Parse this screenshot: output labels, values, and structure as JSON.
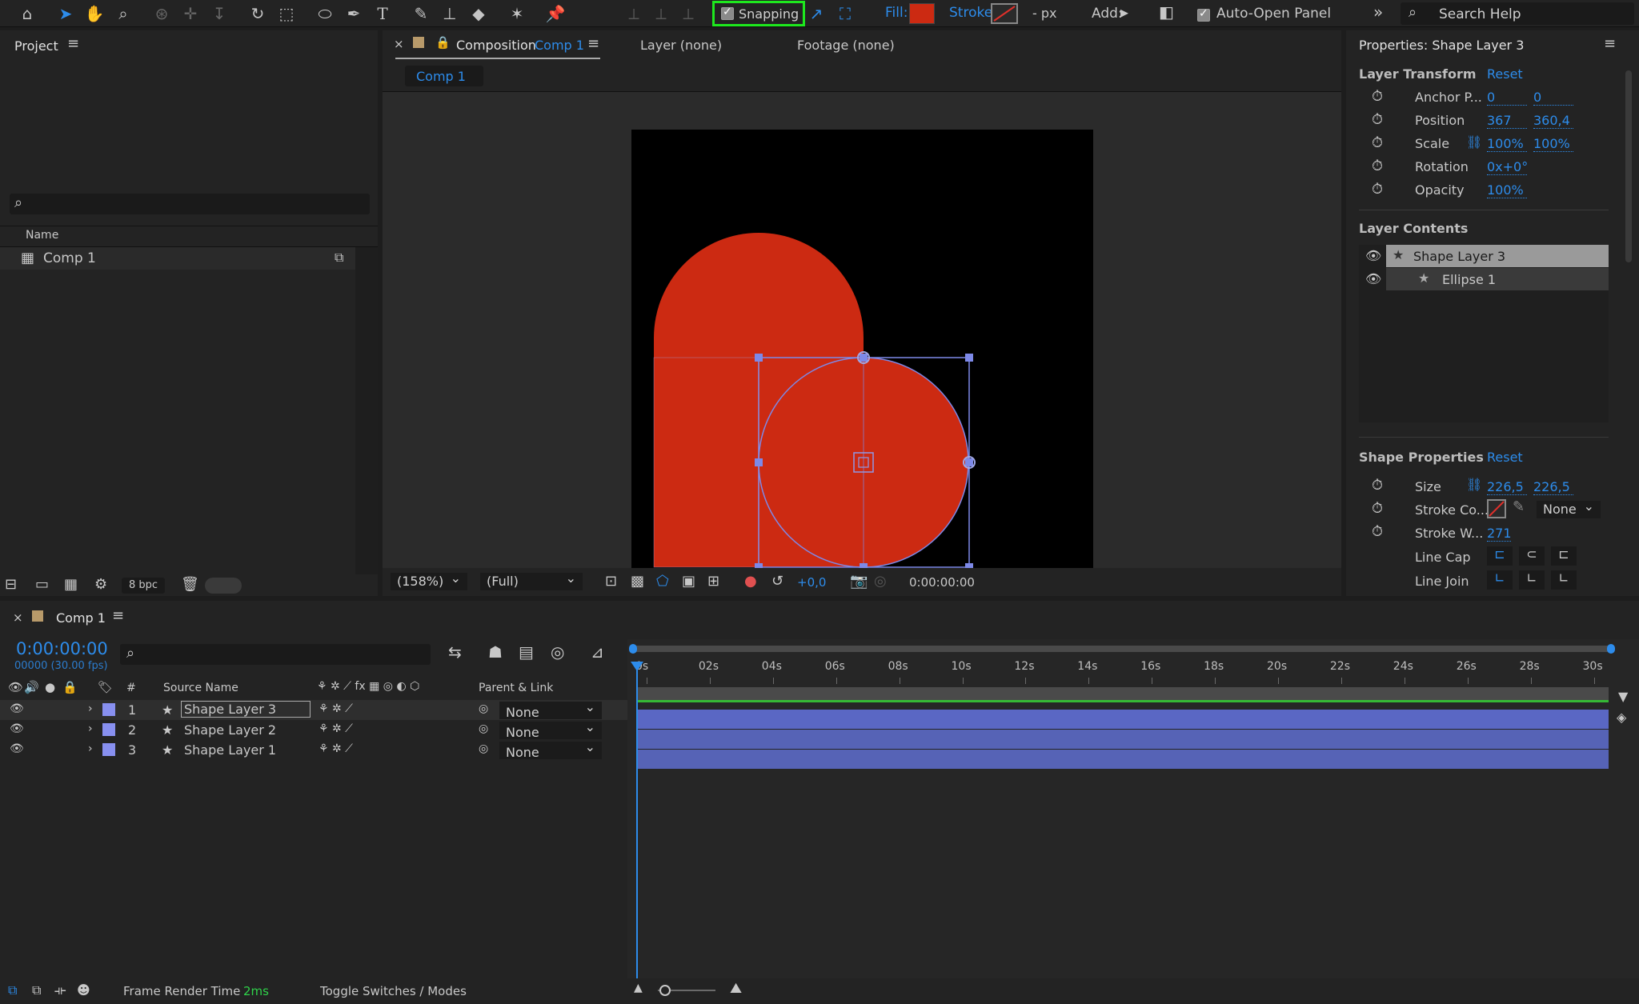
{
  "toolbar": {
    "snapping_label": "Snapping",
    "fill_label": "Fill:",
    "stroke_label": "Stroke:",
    "stroke_px": "- px",
    "add_label": "Add:",
    "auto_open_label": "Auto-Open Panel",
    "search_placeholder": "Search Help",
    "fill_color": "#cc2a12"
  },
  "project": {
    "title": "Project",
    "name_header": "Name",
    "items": [
      "Comp 1"
    ],
    "bpc": "8 bpc"
  },
  "composition": {
    "tab_prefix": "Composition",
    "tab_comp": "Comp 1",
    "layer_tab": "Layer (none)",
    "footage_tab": "Footage (none)",
    "breadcrumb": "Comp 1",
    "zoom": "(158%)",
    "resolution": "(Full)",
    "exposure": "+0,0",
    "timecode": "0:00:00:00"
  },
  "properties": {
    "title": "Properties: Shape Layer 3",
    "layer_transform": "Layer Transform",
    "reset": "Reset",
    "anchor_label": "Anchor P...",
    "anchor_x": "0",
    "anchor_y": "0",
    "position_label": "Position",
    "position_x": "367",
    "position_y": "360,4",
    "scale_label": "Scale",
    "scale_x": "100%",
    "scale_y": "100%",
    "rotation_label": "Rotation",
    "rotation_value": "0x+0°",
    "opacity_label": "Opacity",
    "opacity_value": "100%",
    "layer_contents": "Layer Contents",
    "contents": [
      "Shape Layer 3",
      "Ellipse 1"
    ],
    "shape_properties": "Shape Properties",
    "size_label": "Size",
    "size_x": "226,5",
    "size_y": "226,5",
    "stroke_color_label": "Stroke Co...",
    "stroke_none": "None",
    "stroke_width_label": "Stroke W...",
    "stroke_width_value": "271",
    "line_cap_label": "Line Cap",
    "line_join_label": "Line Join"
  },
  "timeline": {
    "comp_tab": "Comp 1",
    "timecode": "0:00:00:00",
    "frame_info": "00000 (30.00 fps)",
    "col_hash": "#",
    "col_source": "Source Name",
    "col_parent": "Parent & Link",
    "layers": [
      {
        "num": "1",
        "name": "Shape Layer 3",
        "parent": "None"
      },
      {
        "num": "2",
        "name": "Shape Layer 2",
        "parent": "None"
      },
      {
        "num": "3",
        "name": "Shape Layer 1",
        "parent": "None"
      }
    ],
    "ticks": [
      "0s",
      "02s",
      "04s",
      "06s",
      "08s",
      "10s",
      "12s",
      "14s",
      "16s",
      "18s",
      "20s",
      "22s",
      "24s",
      "26s",
      "28s",
      "30s"
    ],
    "render_label": "Frame Render Time",
    "render_value": "2ms",
    "toggle_label": "Toggle Switches / Modes"
  }
}
